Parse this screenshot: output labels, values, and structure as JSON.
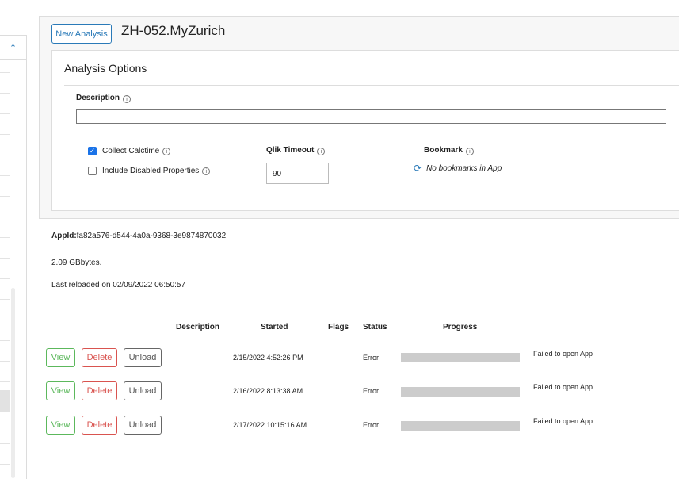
{
  "header": {
    "new_analysis_label": "New Analysis",
    "app_title": "ZH-052.MyZurich"
  },
  "options": {
    "title": "Analysis Options",
    "description_label": "Description",
    "description_value": "",
    "collect_calctime": {
      "label": "Collect Calctime",
      "checked": true
    },
    "include_disabled": {
      "label": "Include Disabled Properties",
      "checked": false
    },
    "qlik_timeout_label": "Qlik Timeout",
    "qlik_timeout_value": "90",
    "bookmark_label": "Bookmark",
    "bookmark_empty_text": "No bookmarks in App"
  },
  "app_info": {
    "appid_label": "AppId:",
    "appid_value": "fa82a576-d544-4a0a-9368-3e9874870032",
    "size_text": "2.09 GBbytes.",
    "last_reloaded_text": "Last reloaded on 02/09/2022 06:50:57"
  },
  "table": {
    "columns": [
      "Description",
      "Started",
      "Flags",
      "Status",
      "Progress"
    ],
    "buttons": {
      "view": "View",
      "delete": "Delete",
      "unload": "Unload"
    },
    "rows": [
      {
        "description": "",
        "started": "2/15/2022 4:52:26 PM",
        "flags": "",
        "status": "Error",
        "progress": 0,
        "message": "Failed to open App"
      },
      {
        "description": "",
        "started": "2/16/2022 8:13:38 AM",
        "flags": "",
        "status": "Error",
        "progress": 0,
        "message": "Failed to open App"
      },
      {
        "description": "",
        "started": "2/17/2022 10:15:16 AM",
        "flags": "",
        "status": "Error",
        "progress": 0,
        "message": "Failed to open App"
      }
    ]
  },
  "colors": {
    "accent": "#2a7ab8",
    "view": "#5cb85c",
    "delete": "#d9534f",
    "checkbox": "#1a73e8"
  },
  "icons": {
    "collapse": "chevron-up-icon",
    "info": "info-icon",
    "refresh": "refresh-icon"
  }
}
